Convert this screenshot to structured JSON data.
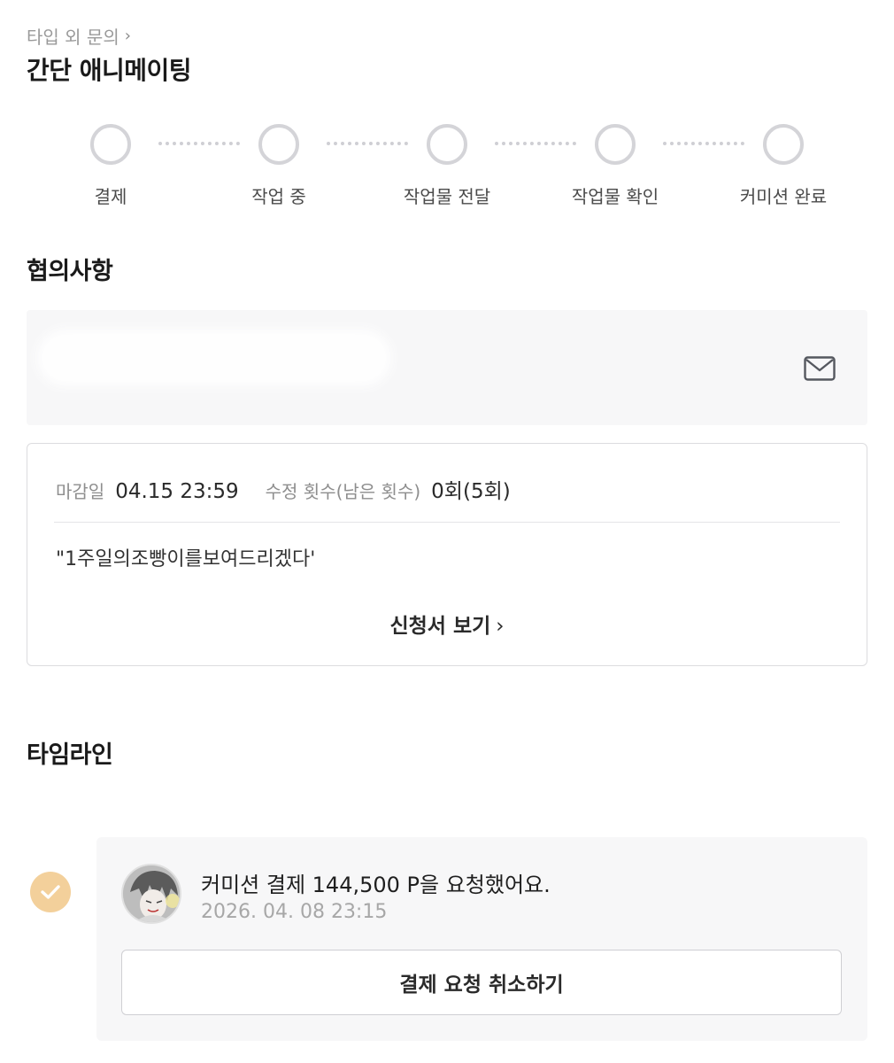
{
  "header": {
    "breadcrumb": "타입 외 문의",
    "title": "간단 애니메이팅"
  },
  "steps": [
    {
      "label": "결제",
      "completed": false
    },
    {
      "label": "작업 중",
      "completed": false
    },
    {
      "label": "작업물 전달",
      "completed": false
    },
    {
      "label": "작업물 확인",
      "completed": false
    },
    {
      "label": "커미션 완료",
      "completed": false
    }
  ],
  "agreement": {
    "title": "협의사항",
    "icon": "mail-icon"
  },
  "info": {
    "deadline_label": "마감일",
    "deadline_value": "04.15 23:59",
    "revisions_label": "수정 횟수(남은 횟수)",
    "revisions_value": "0회(5회)",
    "quote": "\"1주일의조빵이를보여드리겠다'",
    "view_link": "신청서 보기"
  },
  "timeline": {
    "title": "타임라인",
    "items": [
      {
        "message": "커미션 결제 144,500 P을 요청했어요.",
        "time": "2026. 04. 08 23:15",
        "button": "결제 요청 취소하기"
      }
    ]
  },
  "colors": {
    "step_circle": "#d4d4d8",
    "check_badge": "#f3d09b",
    "card_bg": "#f7f7f8"
  }
}
